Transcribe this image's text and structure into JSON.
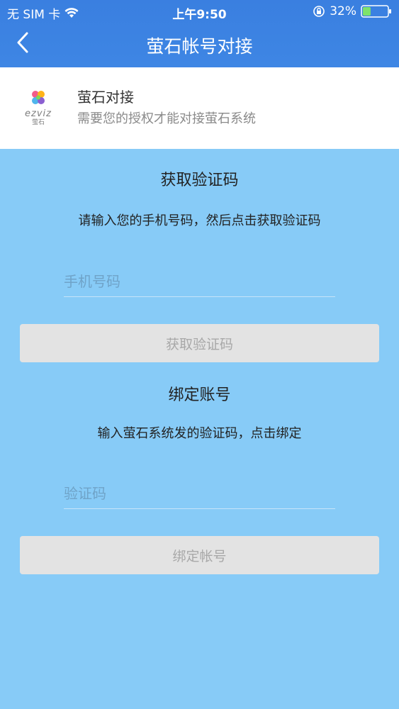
{
  "status_bar": {
    "carrier": "无 SIM 卡",
    "time": "上午9:50",
    "battery_percent": "32%",
    "battery_level": 0.32
  },
  "nav": {
    "back_icon": "chevron-left-icon",
    "title": "萤石帐号对接"
  },
  "intro_card": {
    "logo_word": "ezviz",
    "logo_cn": "萤石",
    "title": "萤石对接",
    "subtitle": "需要您的授权才能对接萤石系统"
  },
  "get_code_section": {
    "title": "获取验证码",
    "instruction": "请输入您的手机号码，然后点击获取验证码",
    "phone_placeholder": "手机号码",
    "button_label": "获取验证码"
  },
  "bind_section": {
    "title": "绑定账号",
    "instruction": "输入萤石系统发的验证码，点击绑定",
    "code_placeholder": "验证码",
    "button_label": "绑定帐号"
  },
  "colors": {
    "header": "#3a7fe0",
    "background": "#87cbf7",
    "button_bg": "#e3e3e3",
    "button_text": "#a8a8a8"
  }
}
